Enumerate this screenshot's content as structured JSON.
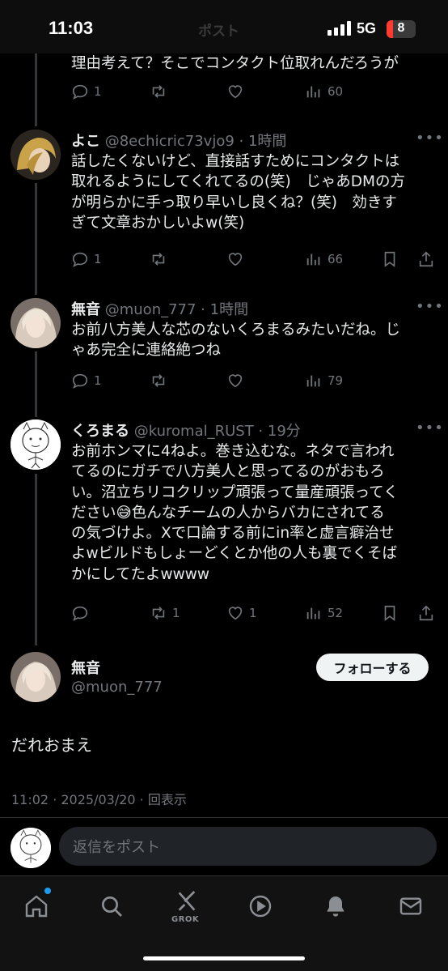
{
  "status_bar": {
    "time": "11:03",
    "title": "ポスト",
    "network": "5G",
    "battery": "8"
  },
  "posts": [
    {
      "text_lines": [
        "理由考えて？そこでコンタクト位取れんだろうが"
      ],
      "reply_count": "1",
      "repost_count": "",
      "like_count": "",
      "view_count": "60"
    },
    {
      "name": "よこ",
      "meta": "@8echicric73vjo9 · 1時間",
      "text_lines": [
        "話したくないけど、直接話すためにコンタクトは",
        "取れるようにしてくれてるの(笑)　じゃあDMの方",
        "が明らかに手っ取り早いし良くね？(笑)　効きす",
        "ぎて文章おかしいよw(笑)"
      ],
      "reply_count": "1",
      "repost_count": "",
      "like_count": "",
      "view_count": "66"
    },
    {
      "name": "無音",
      "meta": "@muon_777 · 1時間",
      "text_lines": [
        "お前八方美人な芯のないくろまるみたいだね。じ",
        "ゃあ完全に連絡絶つね"
      ],
      "reply_count": "1",
      "repost_count": "",
      "like_count": "",
      "view_count": "79"
    },
    {
      "name": "くろまる",
      "meta": "@kuromal_RUST · 19分",
      "text_lines": [
        "お前ホンマに4ねよ。巻き込むな。ネタで言われ",
        "てるのにガチで八方美人と思ってるのがおもろ",
        "い。沼立ちリコクリップ頑張って量産頑張ってく",
        "ださい😅色んなチームの人からバカにされてる",
        "の気づけよ。Xで口論する前にin率と虚言癖治せ",
        "よwビルドもしょーどくとか他の人も裏でくそば",
        "かにしてたよwwww"
      ],
      "reply_count": "",
      "repost_count": "1",
      "like_count": "1",
      "view_count": "52"
    }
  ],
  "main_post": {
    "name": "無音",
    "handle": "@muon_777",
    "follow_label": "フォローする",
    "text": "だれおまえ",
    "timestamp": "11:02 · 2025/03/20 · 回表示"
  },
  "reply": {
    "placeholder": "返信をポスト"
  },
  "tabs": {
    "grok_label": "GROK"
  },
  "colors": {
    "background": "#000000",
    "text": "#e7e9ea",
    "muted": "#71767b",
    "accent": "#1d9bf0"
  }
}
